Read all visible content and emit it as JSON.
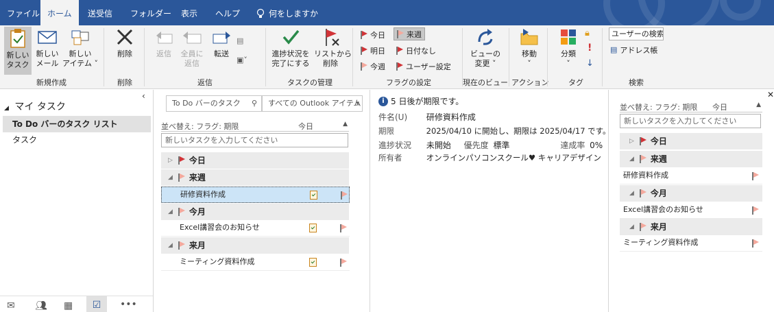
{
  "tabs": [
    "ファイル",
    "ホーム",
    "送受信",
    "フォルダー",
    "表示",
    "ヘルプ",
    "何をしますか"
  ],
  "ribbon": {
    "new": {
      "new_task": "新しい\nタスク",
      "new_mail": "新しい\nメール",
      "new_item": "新しい\nアイテム ˅",
      "label": "新規作成"
    },
    "delete": {
      "button": "削除",
      "label": "削除"
    },
    "respond": {
      "reply": "返信",
      "reply_all": "全員に\n返信",
      "forward": "転送",
      "label": "返信"
    },
    "manage": {
      "mark_complete": "進捗状況を\n完了にする",
      "remove_from_list": "リストから\n削除",
      "label": "タスクの管理"
    },
    "follow_up": {
      "today": "今日",
      "tomorrow": "明日",
      "this_week": "今週",
      "next_week": "来週",
      "no_date": "日付なし",
      "custom": "ユーザー設定",
      "label": "フラグの設定"
    },
    "current_view": {
      "change_view": "ビューの\n変更 ˅",
      "label": "現在のビュー"
    },
    "actions": {
      "move": "移動\n˅",
      "label": "アクション"
    },
    "tags": {
      "categorize": "分類\n˅",
      "label": "タグ"
    },
    "find": {
      "search_people": "ユーザーの検索",
      "address_book": "アドレス帳",
      "label": "検索"
    }
  },
  "nav": {
    "header": "マイ タスク",
    "items": [
      "To Do バーのタスク リスト",
      "タスク"
    ]
  },
  "list": {
    "search_placeholder": "To Do バーのタスク",
    "scope": "すべての Outlook アイテム",
    "sort_label": "並べ替え: フラグ: 期限",
    "sort_value": "今日",
    "new_task_placeholder": "新しいタスクを入力してください",
    "groups": [
      {
        "name": "今日",
        "items": []
      },
      {
        "name": "来週",
        "items": [
          "研修資料作成"
        ]
      },
      {
        "name": "今月",
        "items": [
          "Excel講習会のお知らせ"
        ]
      },
      {
        "name": "来月",
        "items": [
          "ミーティング資料作成"
        ]
      }
    ]
  },
  "reading": {
    "info": "5 日後が期限です。",
    "subject_label": "件名(U)",
    "subject": "研修資料作成",
    "due_label": "期限",
    "due": "2025/04/10 に開始し、期限は 2025/04/17 です。",
    "status_label": "進捗状況",
    "status": "未開始",
    "priority_label": "優先度",
    "priority": "標準",
    "percent_label": "達成率",
    "percent": "0%",
    "owner_label": "所有者",
    "owner": "オンラインパソコンスクール♥ キャリアデザイン"
  },
  "todo": {
    "sort_label": "並べ替え: フラグ: 期限",
    "sort_value": "今日",
    "new_task_placeholder": "新しいタスクを入力してください",
    "groups": [
      {
        "name": "今日",
        "items": []
      },
      {
        "name": "来週",
        "items": [
          "研修資料作成"
        ]
      },
      {
        "name": "今月",
        "items": [
          "Excel講習会のお知らせ"
        ]
      },
      {
        "name": "来月",
        "items": [
          "ミーティング資料作成"
        ]
      }
    ]
  },
  "colors": {
    "accent": "#2b579a",
    "flag_red": "#d13438",
    "flag_light": "#f4a99d",
    "selected_row": "#cce4f7"
  }
}
